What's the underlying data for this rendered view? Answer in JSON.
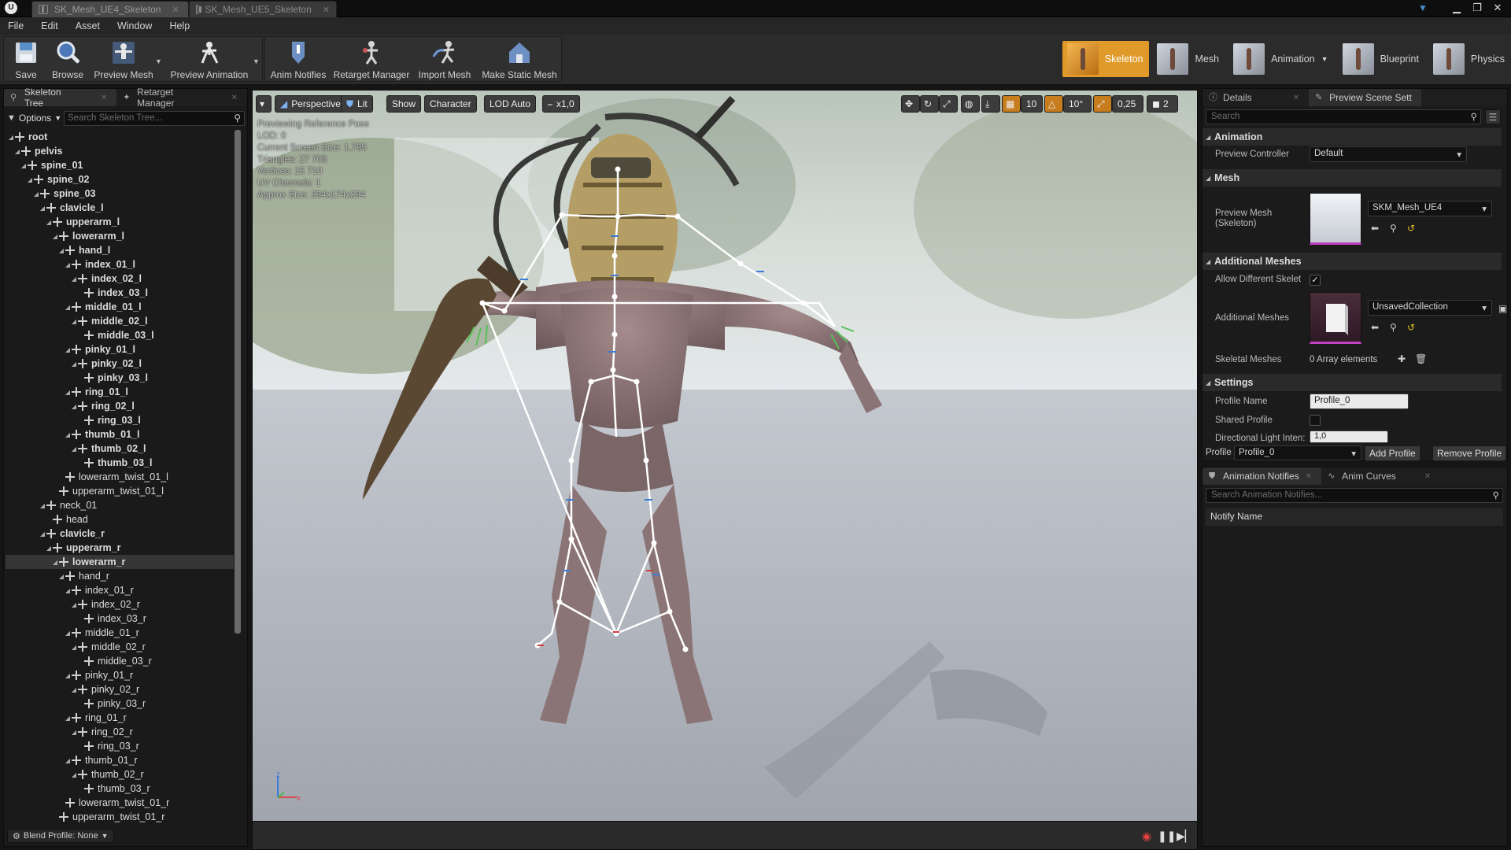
{
  "titlebar": {
    "logo": "U",
    "tabs": [
      "SK_Mesh_UE4_Skeleton",
      "SK_Mesh_UE5_Skeleton"
    ]
  },
  "menu": [
    "File",
    "Edit",
    "Asset",
    "Window",
    "Help"
  ],
  "toolbar": {
    "save": "Save",
    "browse": "Browse",
    "preview_mesh": "Preview Mesh",
    "preview_animation": "Preview Animation",
    "anim_notifies": "Anim Notifies",
    "retarget_manager": "Retarget Manager",
    "import_mesh": "Import Mesh",
    "make_static_mesh": "Make Static Mesh"
  },
  "modes": [
    "Skeleton",
    "Mesh",
    "Animation",
    "Blueprint",
    "Physics"
  ],
  "left_panel": {
    "tabs": [
      "Skeleton Tree",
      "Retarget Manager"
    ],
    "options": "Options",
    "search_placeholder": "Search Skeleton Tree...",
    "blend_profile": "Blend Profile: None",
    "bones": [
      {
        "name": "root",
        "depth": 0,
        "bold": true
      },
      {
        "name": "pelvis",
        "depth": 1,
        "bold": true
      },
      {
        "name": "spine_01",
        "depth": 2,
        "bold": true
      },
      {
        "name": "spine_02",
        "depth": 3,
        "bold": true
      },
      {
        "name": "spine_03",
        "depth": 4,
        "bold": true
      },
      {
        "name": "clavicle_l",
        "depth": 5,
        "bold": true
      },
      {
        "name": "upperarm_l",
        "depth": 6,
        "bold": true
      },
      {
        "name": "lowerarm_l",
        "depth": 7,
        "bold": true
      },
      {
        "name": "hand_l",
        "depth": 8,
        "bold": true
      },
      {
        "name": "index_01_l",
        "depth": 9,
        "bold": true
      },
      {
        "name": "index_02_l",
        "depth": 10,
        "bold": true
      },
      {
        "name": "index_03_l",
        "depth": 11,
        "bold": true
      },
      {
        "name": "middle_01_l",
        "depth": 9,
        "bold": true
      },
      {
        "name": "middle_02_l",
        "depth": 10,
        "bold": true
      },
      {
        "name": "middle_03_l",
        "depth": 11,
        "bold": true
      },
      {
        "name": "pinky_01_l",
        "depth": 9,
        "bold": true
      },
      {
        "name": "pinky_02_l",
        "depth": 10,
        "bold": true
      },
      {
        "name": "pinky_03_l",
        "depth": 11,
        "bold": true
      },
      {
        "name": "ring_01_l",
        "depth": 9,
        "bold": true
      },
      {
        "name": "ring_02_l",
        "depth": 10,
        "bold": true
      },
      {
        "name": "ring_03_l",
        "depth": 11,
        "bold": true
      },
      {
        "name": "thumb_01_l",
        "depth": 9,
        "bold": true
      },
      {
        "name": "thumb_02_l",
        "depth": 10,
        "bold": true
      },
      {
        "name": "thumb_03_l",
        "depth": 11,
        "bold": true
      },
      {
        "name": "lowerarm_twist_01_l",
        "depth": 8,
        "bold": false
      },
      {
        "name": "upperarm_twist_01_l",
        "depth": 7,
        "bold": false
      },
      {
        "name": "neck_01",
        "depth": 5,
        "bold": false
      },
      {
        "name": "head",
        "depth": 6,
        "bold": false
      },
      {
        "name": "clavicle_r",
        "depth": 5,
        "bold": true
      },
      {
        "name": "upperarm_r",
        "depth": 6,
        "bold": true
      },
      {
        "name": "lowerarm_r",
        "depth": 7,
        "bold": true,
        "selected": true
      },
      {
        "name": "hand_r",
        "depth": 8,
        "bold": false
      },
      {
        "name": "index_01_r",
        "depth": 9,
        "bold": false
      },
      {
        "name": "index_02_r",
        "depth": 10,
        "bold": false
      },
      {
        "name": "index_03_r",
        "depth": 11,
        "bold": false
      },
      {
        "name": "middle_01_r",
        "depth": 9,
        "bold": false
      },
      {
        "name": "middle_02_r",
        "depth": 10,
        "bold": false
      },
      {
        "name": "middle_03_r",
        "depth": 11,
        "bold": false
      },
      {
        "name": "pinky_01_r",
        "depth": 9,
        "bold": false
      },
      {
        "name": "pinky_02_r",
        "depth": 10,
        "bold": false
      },
      {
        "name": "pinky_03_r",
        "depth": 11,
        "bold": false
      },
      {
        "name": "ring_01_r",
        "depth": 9,
        "bold": false
      },
      {
        "name": "ring_02_r",
        "depth": 10,
        "bold": false
      },
      {
        "name": "ring_03_r",
        "depth": 11,
        "bold": false
      },
      {
        "name": "thumb_01_r",
        "depth": 9,
        "bold": false
      },
      {
        "name": "thumb_02_r",
        "depth": 10,
        "bold": false
      },
      {
        "name": "thumb_03_r",
        "depth": 11,
        "bold": false
      },
      {
        "name": "lowerarm_twist_01_r",
        "depth": 8,
        "bold": false
      },
      {
        "name": "upperarm_twist_01_r",
        "depth": 7,
        "bold": false
      }
    ]
  },
  "viewport": {
    "perspective": "Perspective",
    "lit": "Lit",
    "show": "Show",
    "character": "Character",
    "lod": "LOD Auto",
    "speed": "x1,0",
    "grid_snap": "10",
    "rot_snap": "10°",
    "scale_snap": "0,25",
    "cam_speed": "2",
    "stats": [
      "Previewing Reference Pose",
      "LOD: 0",
      "Current Screen Size: 1,795",
      "Triangles: 27 706",
      "Vertices: 15 710",
      "UV Channels: 1",
      "Approx Size: 294x174x294"
    ],
    "axis_z": "z",
    "axis_x": "x"
  },
  "details": {
    "tabs": [
      "Details",
      "Preview Scene Sett"
    ],
    "search_placeholder": "Search",
    "animation_cat": "Animation",
    "preview_controller_label": "Preview Controller",
    "preview_controller_value": "Default",
    "mesh_cat": "Mesh",
    "preview_mesh_label": "Preview Mesh",
    "preview_mesh_sub": "(Skeleton)",
    "preview_mesh_value": "SKM_Mesh_UE4",
    "additional_cat": "Additional Meshes",
    "allow_diff_label": "Allow Different Skelet",
    "additional_label": "Additional Meshes",
    "additional_value": "UnsavedCollection",
    "skeletal_label": "Skeletal Meshes",
    "skeletal_value": "0 Array elements",
    "settings_cat": "Settings",
    "profile_name_label": "Profile Name",
    "profile_name_value": "Profile_0",
    "shared_profile_label": "Shared Profile",
    "dir_light_label": "Directional Light Inten:",
    "dir_light_value": "1,0",
    "profile_label": "Profile",
    "profile_value": "Profile_0",
    "add_profile": "Add Profile",
    "remove_profile": "Remove Profile"
  },
  "notifies": {
    "tabs": [
      "Animation Notifies",
      "Anim Curves"
    ],
    "search_placeholder": "Search Animation Notifies...",
    "header": "Notify Name"
  },
  "colors": {
    "accent": "#e09a2a",
    "bg": "#151515",
    "panel": "#1b1b1b"
  }
}
